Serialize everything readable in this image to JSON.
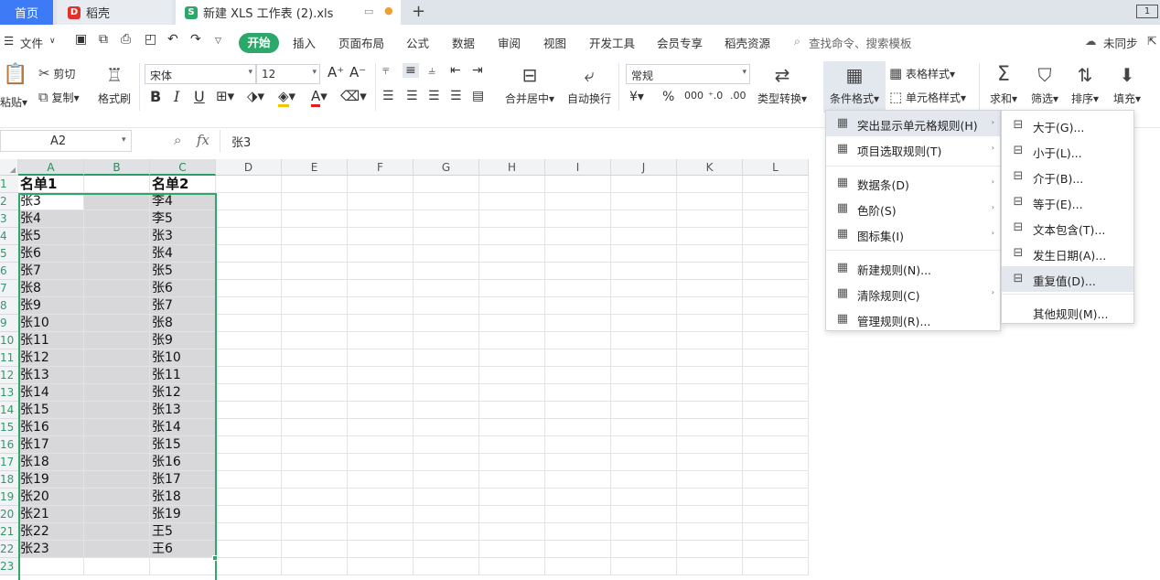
{
  "tabs": {
    "home": "首页",
    "daoke": "稻壳",
    "file": "新建 XLS 工作表 (2).xls",
    "add": "+"
  },
  "menu": {
    "file": "文件",
    "items": [
      "开始",
      "插入",
      "页面布局",
      "公式",
      "数据",
      "审阅",
      "视图",
      "开发工具",
      "会员专享",
      "稻壳资源"
    ],
    "search": "查找命令、搜索模板",
    "sync": "未同步"
  },
  "ribbon": {
    "paste": "粘贴",
    "cut": "剪切",
    "copy": "复制",
    "format_painter": "格式刷",
    "font": "宋体",
    "size": "12",
    "merge": "合并居中",
    "wrap": "自动换行",
    "number_format": "常规",
    "type_convert": "类型转换",
    "cond_format": "条件格式",
    "table_style": "表格样式",
    "cell_style": "单元格样式",
    "sum": "求和",
    "filter": "筛选",
    "sort": "排序",
    "fill": "填充"
  },
  "formula": {
    "cell_ref": "A2",
    "fx": "fx",
    "value": "张3"
  },
  "grid": {
    "columns": [
      "A",
      "B",
      "C",
      "D",
      "E",
      "F",
      "G",
      "H",
      "I",
      "J",
      "K",
      "L"
    ],
    "rows": [
      "1",
      "2",
      "3",
      "4",
      "5",
      "6",
      "7",
      "8",
      "9",
      "10",
      "11",
      "12",
      "13",
      "14",
      "15",
      "16",
      "17",
      "18",
      "19",
      "20",
      "21",
      "22",
      "23"
    ],
    "col_a": [
      "名单1",
      "张3",
      "张4",
      "张5",
      "张6",
      "张7",
      "张8",
      "张9",
      "张10",
      "张11",
      "张12",
      "张13",
      "张14",
      "张15",
      "张16",
      "张17",
      "张18",
      "张19",
      "张20",
      "张21",
      "张22",
      "张23",
      ""
    ],
    "col_c": [
      "名单2",
      "李4",
      "李5",
      "张3",
      "张4",
      "张5",
      "张6",
      "张7",
      "张8",
      "张9",
      "张10",
      "张11",
      "张12",
      "张13",
      "张14",
      "张15",
      "张16",
      "张17",
      "张18",
      "张19",
      "王5",
      "王6",
      ""
    ]
  },
  "cond_menu": {
    "items": [
      {
        "icon": "highlight-rules-icon",
        "label": "突出显示单元格规则(H)",
        "arrow": "›"
      },
      {
        "icon": "top-bottom-rules-icon",
        "label": "项目选取规则(T)",
        "arrow": "›"
      },
      {
        "icon": "data-bars-icon",
        "label": "数据条(D)",
        "arrow": "›"
      },
      {
        "icon": "color-scales-icon",
        "label": "色阶(S)",
        "arrow": "›"
      },
      {
        "icon": "icon-sets-icon",
        "label": "图标集(I)",
        "arrow": "›"
      },
      {
        "icon": "new-rule-icon",
        "label": "新建规则(N)...",
        "arrow": ""
      },
      {
        "icon": "clear-rules-icon",
        "label": "清除规则(C)",
        "arrow": "›"
      },
      {
        "icon": "manage-rules-icon",
        "label": "管理规则(R)...",
        "arrow": ""
      }
    ]
  },
  "sub_menu": {
    "items": [
      {
        "icon": "greater-than-icon",
        "label": "大于(G)..."
      },
      {
        "icon": "less-than-icon",
        "label": "小于(L)..."
      },
      {
        "icon": "between-icon",
        "label": "介于(B)..."
      },
      {
        "icon": "equal-to-icon",
        "label": "等于(E)..."
      },
      {
        "icon": "text-contains-icon",
        "label": "文本包含(T)..."
      },
      {
        "icon": "date-occurring-icon",
        "label": "发生日期(A)..."
      },
      {
        "icon": "duplicate-values-icon",
        "label": "重复值(D)..."
      },
      {
        "icon": "",
        "label": "其他规则(M)..."
      }
    ]
  },
  "colors": {
    "accent_green": "#2ca86a",
    "home_blue": "#3d7bf6",
    "selection_gray": "#d8d8da",
    "hover": "#e3e7ee"
  }
}
